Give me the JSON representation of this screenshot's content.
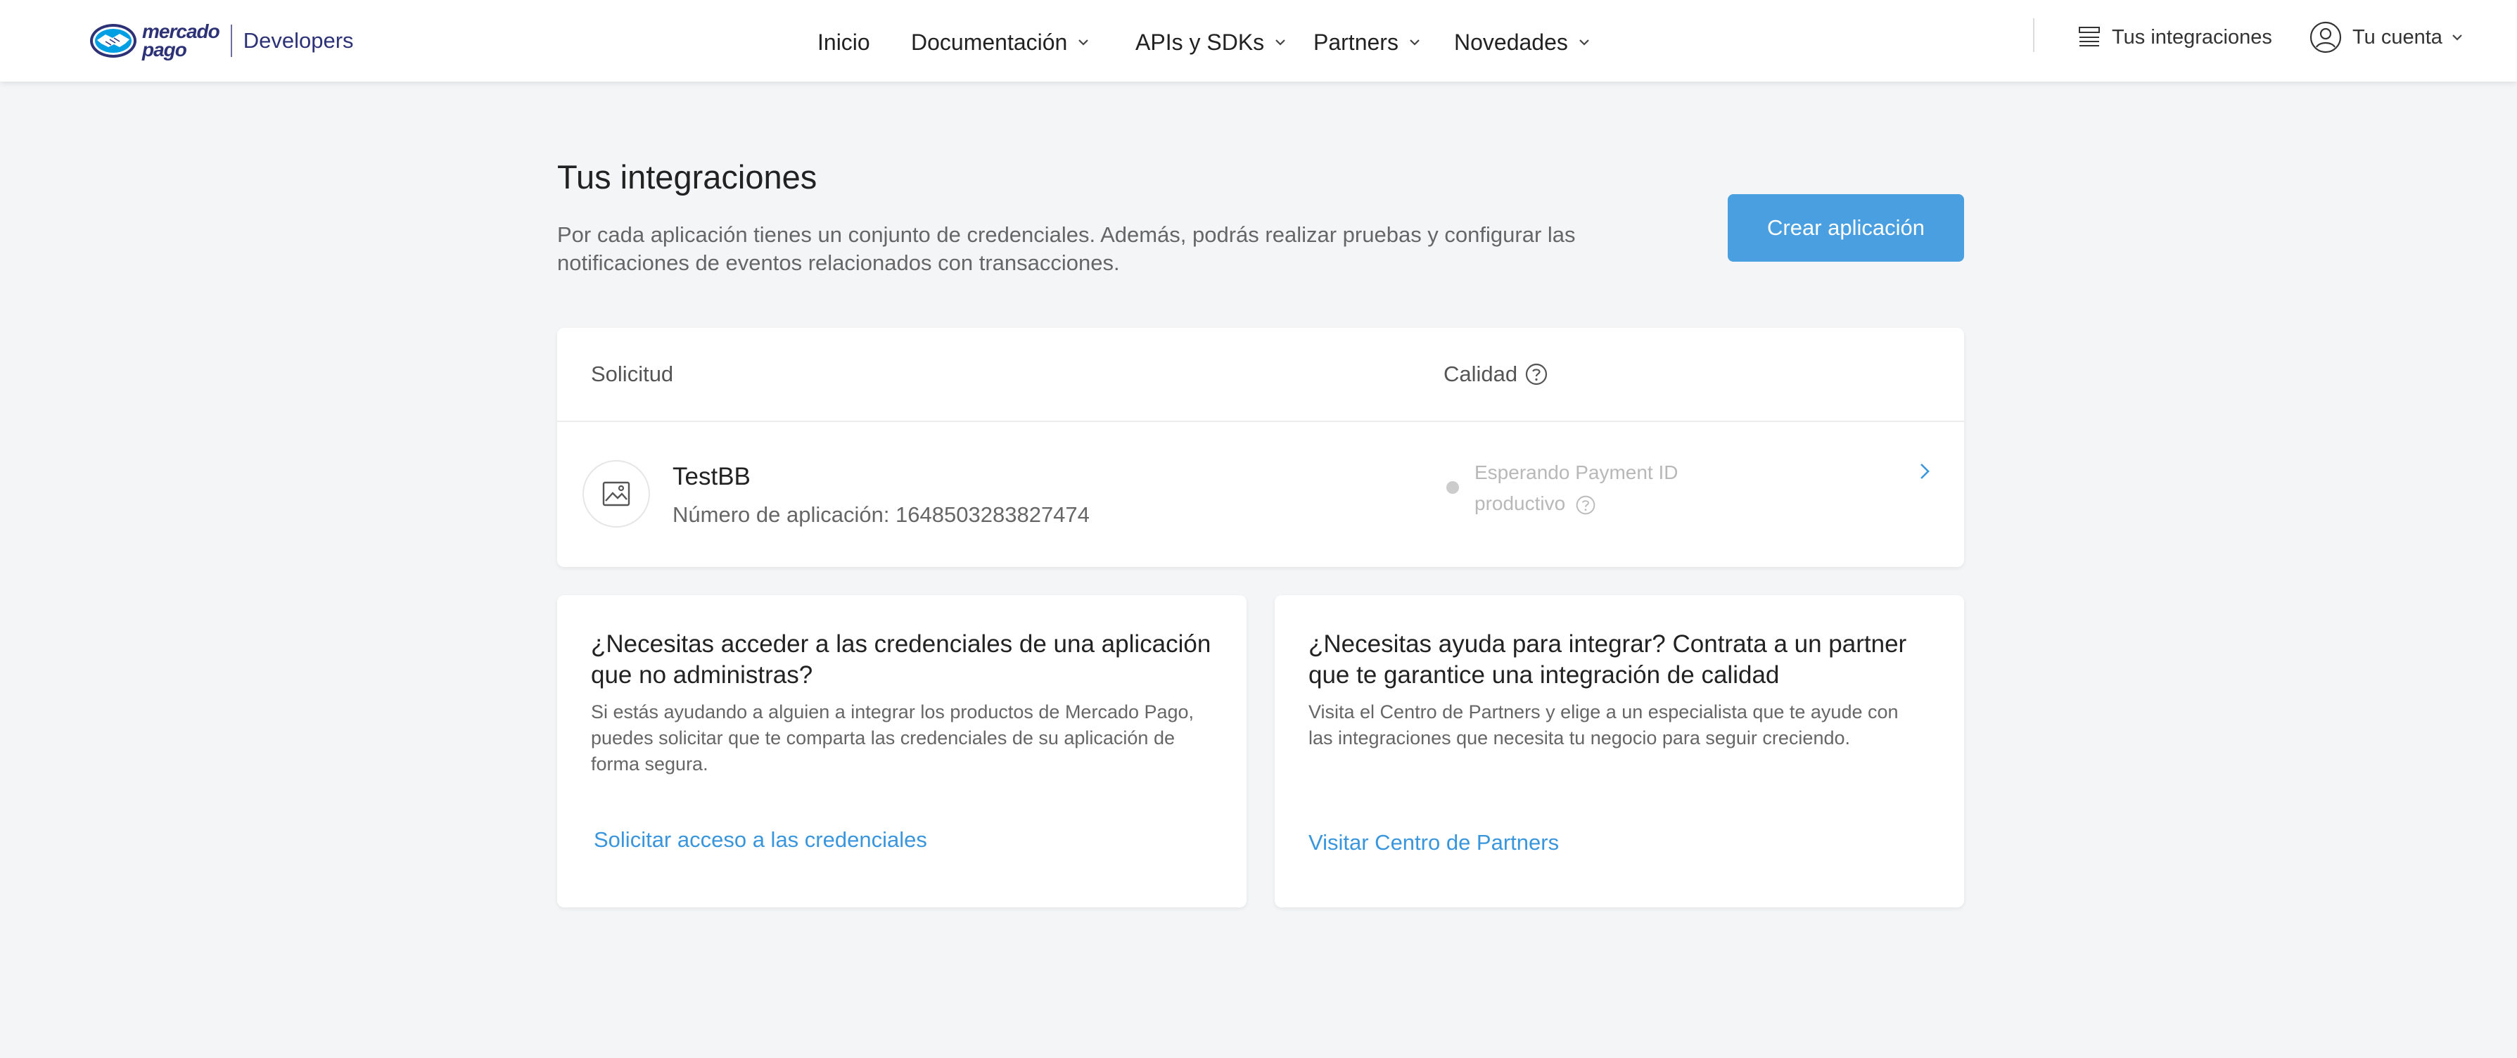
{
  "header": {
    "logo_text_line1": "mercado",
    "logo_text_line2": "pago",
    "logo_product": "Developers",
    "nav": [
      {
        "label": "Inicio"
      },
      {
        "label": "Documentación"
      },
      {
        "label": "APIs y SDKs"
      },
      {
        "label": "Partners"
      },
      {
        "label": "Novedades"
      }
    ],
    "integrations_label": "Tus integraciones",
    "account_label": "Tu cuenta"
  },
  "main": {
    "title": "Tus integraciones",
    "description": "Por cada aplicación tienes un conjunto de credenciales. Además, podrás realizar pruebas y configurar las notificaciones de eventos relacionados con transacciones.",
    "create_button": "Crear aplicación",
    "table": {
      "columns": [
        "Solicitud",
        "Calidad"
      ],
      "rows": [
        {
          "name": "TestBB",
          "number_label": "Número de aplicación: 1648503283827474",
          "status": "Esperando Payment ID productivo"
        }
      ]
    },
    "cards": [
      {
        "title": "¿Necesitas acceder a las credenciales de una aplicación que no administras?",
        "description": "Si estás ayudando a alguien a integrar los productos de Mercado Pago, puedes solicitar que te comparta las credenciales de su aplicación de forma segura.",
        "link": "Solicitar acceso a las credenciales"
      },
      {
        "title": "¿Necesitas ayuda para integrar? Contrata a un partner que te garantice una integración de calidad",
        "description": "Visita el Centro de Partners y elige a un especialista que te ayude con las integraciones que necesita tu negocio para seguir creciendo.",
        "link": "Visitar Centro de Partners"
      }
    ]
  },
  "colors": {
    "brand_navy": "#2d3277",
    "accent_blue": "#4a9fe0",
    "link_blue": "#3a96dc",
    "background": "#f4f5f7"
  }
}
